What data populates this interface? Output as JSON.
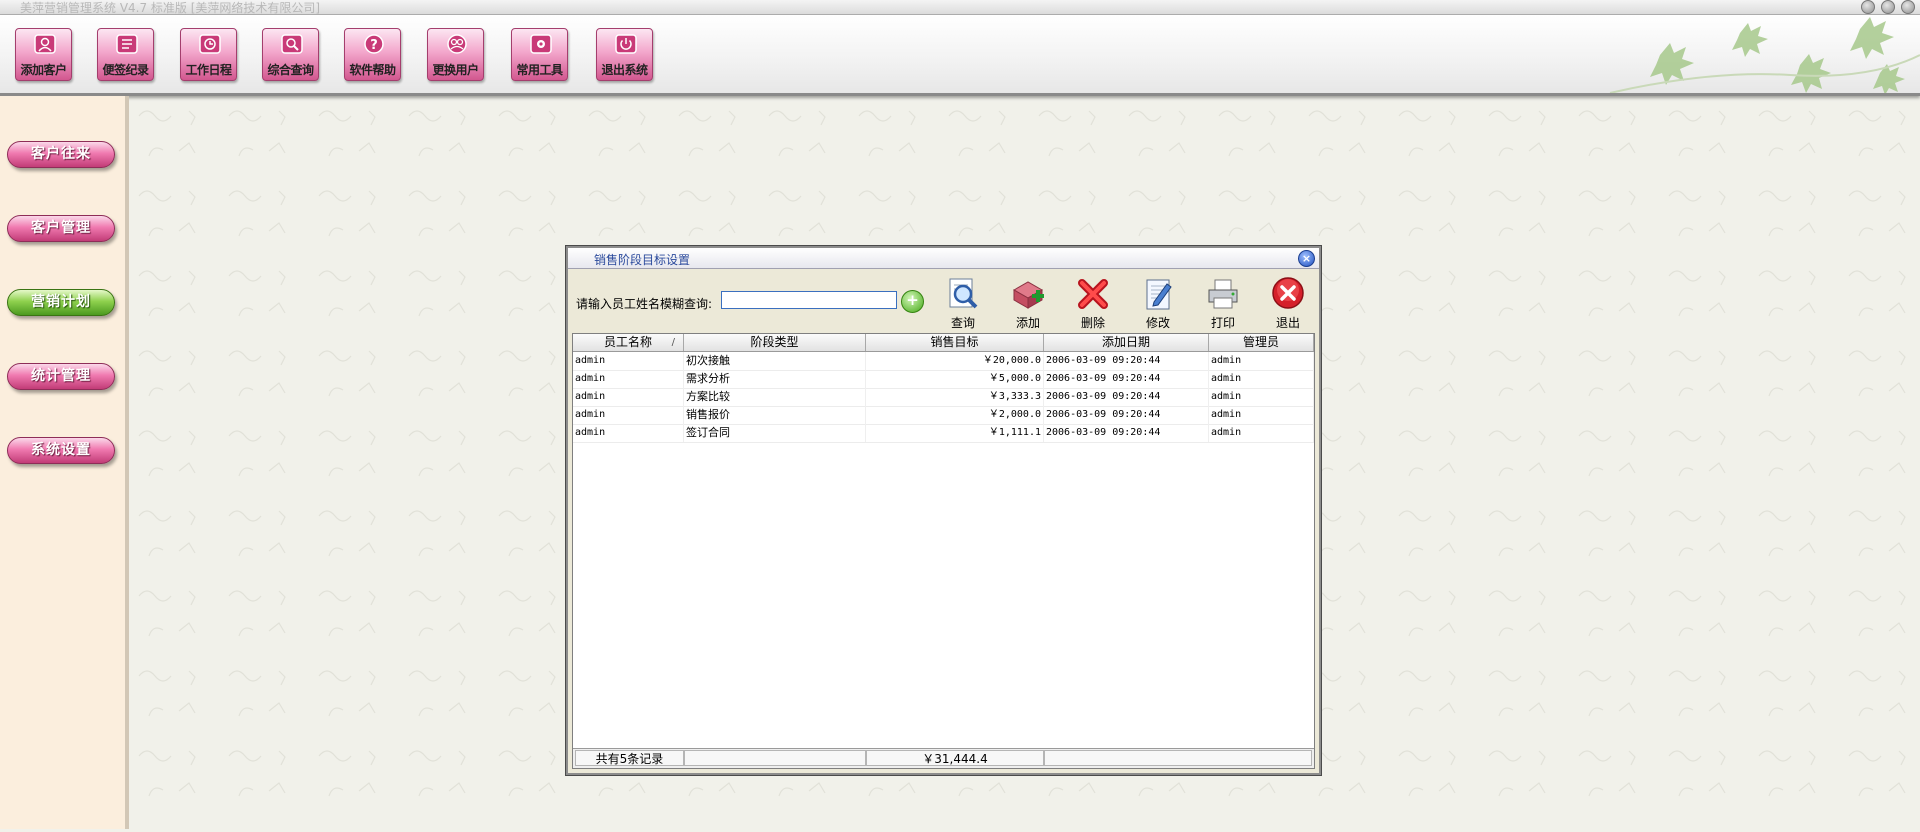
{
  "window": {
    "title": "美萍营销管理系统 V4.7 标准版 [美萍网络技术有限公司]"
  },
  "toolbar": {
    "buttons": [
      {
        "label": "添加客户",
        "icon": "add-customer-icon"
      },
      {
        "label": "便签纪录",
        "icon": "notes-icon"
      },
      {
        "label": "工作日程",
        "icon": "calendar-icon"
      },
      {
        "label": "综合查询",
        "icon": "search-icon"
      },
      {
        "label": "软件帮助",
        "icon": "help-icon"
      },
      {
        "label": "更换用户",
        "icon": "switch-user-icon"
      },
      {
        "label": "常用工具",
        "icon": "tools-icon"
      },
      {
        "label": "退出系统",
        "icon": "power-icon"
      }
    ]
  },
  "sidebar": {
    "items": [
      {
        "label": "客户往来"
      },
      {
        "label": "客户管理"
      },
      {
        "label": "营销计划"
      },
      {
        "label": "统计管理"
      },
      {
        "label": "系统设置"
      }
    ]
  },
  "dialog": {
    "title": "销售阶段目标设置",
    "search_label": "请输入员工姓名模糊查询:",
    "search_value": "",
    "actions": [
      {
        "label": "查询",
        "icon": "query-icon"
      },
      {
        "label": "添加",
        "icon": "add-icon"
      },
      {
        "label": "删除",
        "icon": "delete-icon"
      },
      {
        "label": "修改",
        "icon": "edit-icon"
      },
      {
        "label": "打印",
        "icon": "print-icon"
      },
      {
        "label": "退出",
        "icon": "exit-icon"
      }
    ],
    "grid": {
      "columns": [
        "员工名称",
        "阶段类型",
        "销售目标",
        "添加日期",
        "管理员"
      ],
      "sort_indicator": "/",
      "rows": [
        [
          "admin",
          "初次接触",
          "￥20,000.0",
          "2006-03-09 09:20:44",
          "admin"
        ],
        [
          "admin",
          "需求分析",
          "￥5,000.0",
          "2006-03-09 09:20:44",
          "admin"
        ],
        [
          "admin",
          "方案比较",
          "￥3,333.3",
          "2006-03-09 09:20:44",
          "admin"
        ],
        [
          "admin",
          "销售报价",
          "￥2,000.0",
          "2006-03-09 09:20:44",
          "admin"
        ],
        [
          "admin",
          "签订合同",
          "￥1,111.1",
          "2006-03-09 09:20:44",
          "admin"
        ]
      ],
      "footer": {
        "record_count": "共有5条记录",
        "total": "￥31,444.4"
      }
    }
  },
  "colors": {
    "toolbar_button": "#e57fb0",
    "sidebar_button": "#e0508e",
    "sidebar_active": "#7cc23f",
    "sidebar_bg": "#fbeedd",
    "dialog_title_text": "#2b4a9c"
  }
}
